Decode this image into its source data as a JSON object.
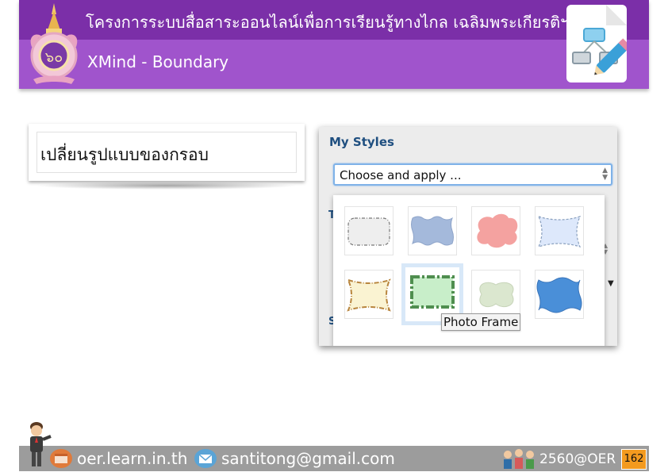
{
  "header": {
    "title": "โครงการระบบสื่อสาระออนไลน์เพื่อการเรียนรู้ทางไกล เฉลิมพระเกียรติฯ",
    "subtitle": "XMind - Boundary",
    "colors": {
      "dark": "#7b2fa8",
      "light": "#a054cc"
    },
    "seal_icon": "royal-seal-icon",
    "app_icon": "xmind-pencil-icon"
  },
  "caption": {
    "text": "เปลี่ยนรูปแบบของกรอบ"
  },
  "panel": {
    "section_title": "My Styles",
    "select_value": "Choose and apply ...",
    "partial_letter_1": "T",
    "partial_letter_2": "S",
    "boundary_styles": [
      {
        "name": "rounded-dashed-gray-boundary"
      },
      {
        "name": "wavy-blue-boundary"
      },
      {
        "name": "cloud-red-boundary"
      },
      {
        "name": "scalloped-light-blue-boundary"
      },
      {
        "name": "scalloped-yellow-boundary"
      },
      {
        "name": "photo-frame-boundary",
        "selected": true
      },
      {
        "name": "cloud-green-boundary"
      },
      {
        "name": "wavy-dark-blue-boundary"
      }
    ],
    "tooltip": "Photo Frame"
  },
  "footer": {
    "website": "oer.learn.in.th",
    "email": "santitong@gmail.com",
    "tag": "2560@OER",
    "page_number": "162",
    "colors": {
      "bar": "#9c9c9c",
      "page": "#f39a1f"
    }
  }
}
